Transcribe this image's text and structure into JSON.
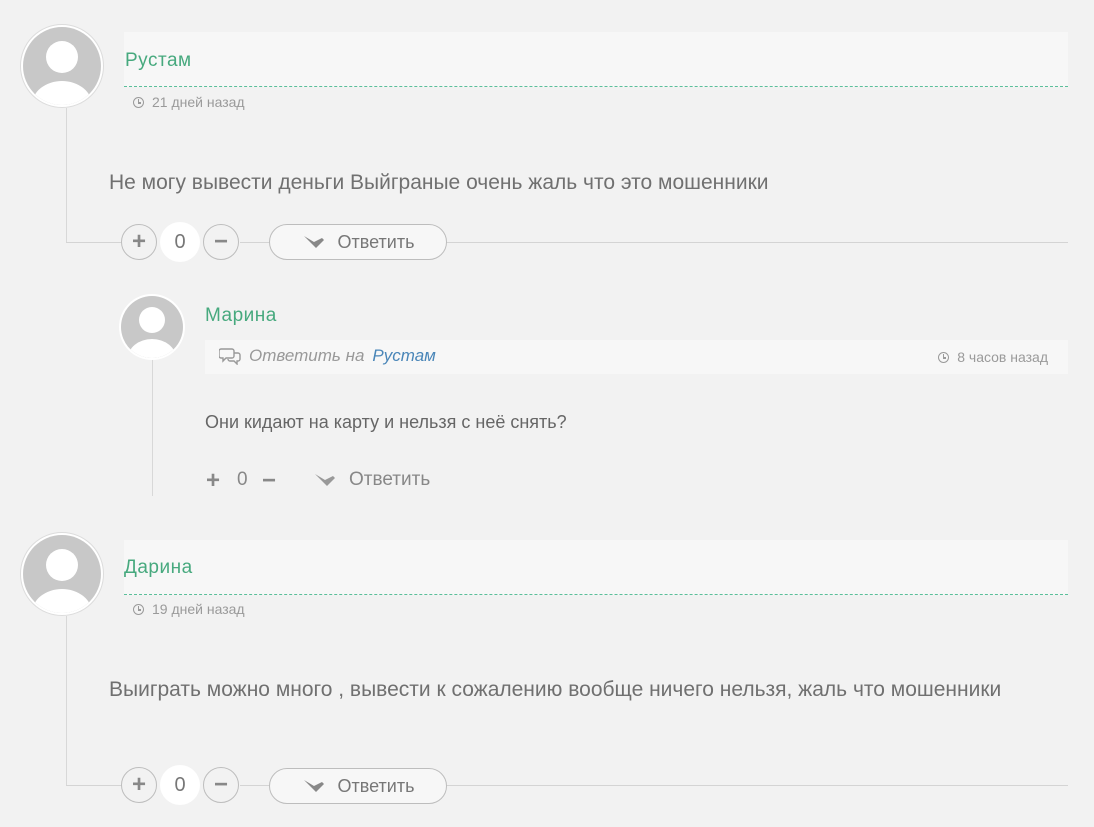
{
  "comments": [
    {
      "author": "Рустам",
      "date": "21 дней назад",
      "text": "Не могу вывести деньги Выйграные очень жаль что это мошенники",
      "votes": "0",
      "reply_label": "Ответить",
      "replies": [
        {
          "author": "Марина",
          "reply_to_prefix": "Ответить на",
          "reply_to_name": "Рустам",
          "date": "8 часов назад",
          "text": "Они кидают на карту и нельзя с неё снять?",
          "votes": "0",
          "reply_label": "Ответить"
        }
      ]
    },
    {
      "author": "Дарина",
      "date": "19 дней назад",
      "text": "Выиграть можно много , вывести к сожалению вообще ничего нельзя, жаль что мошенники",
      "votes": "0",
      "reply_label": "Ответить"
    }
  ],
  "icons": {
    "plus": "+",
    "minus": "−"
  }
}
